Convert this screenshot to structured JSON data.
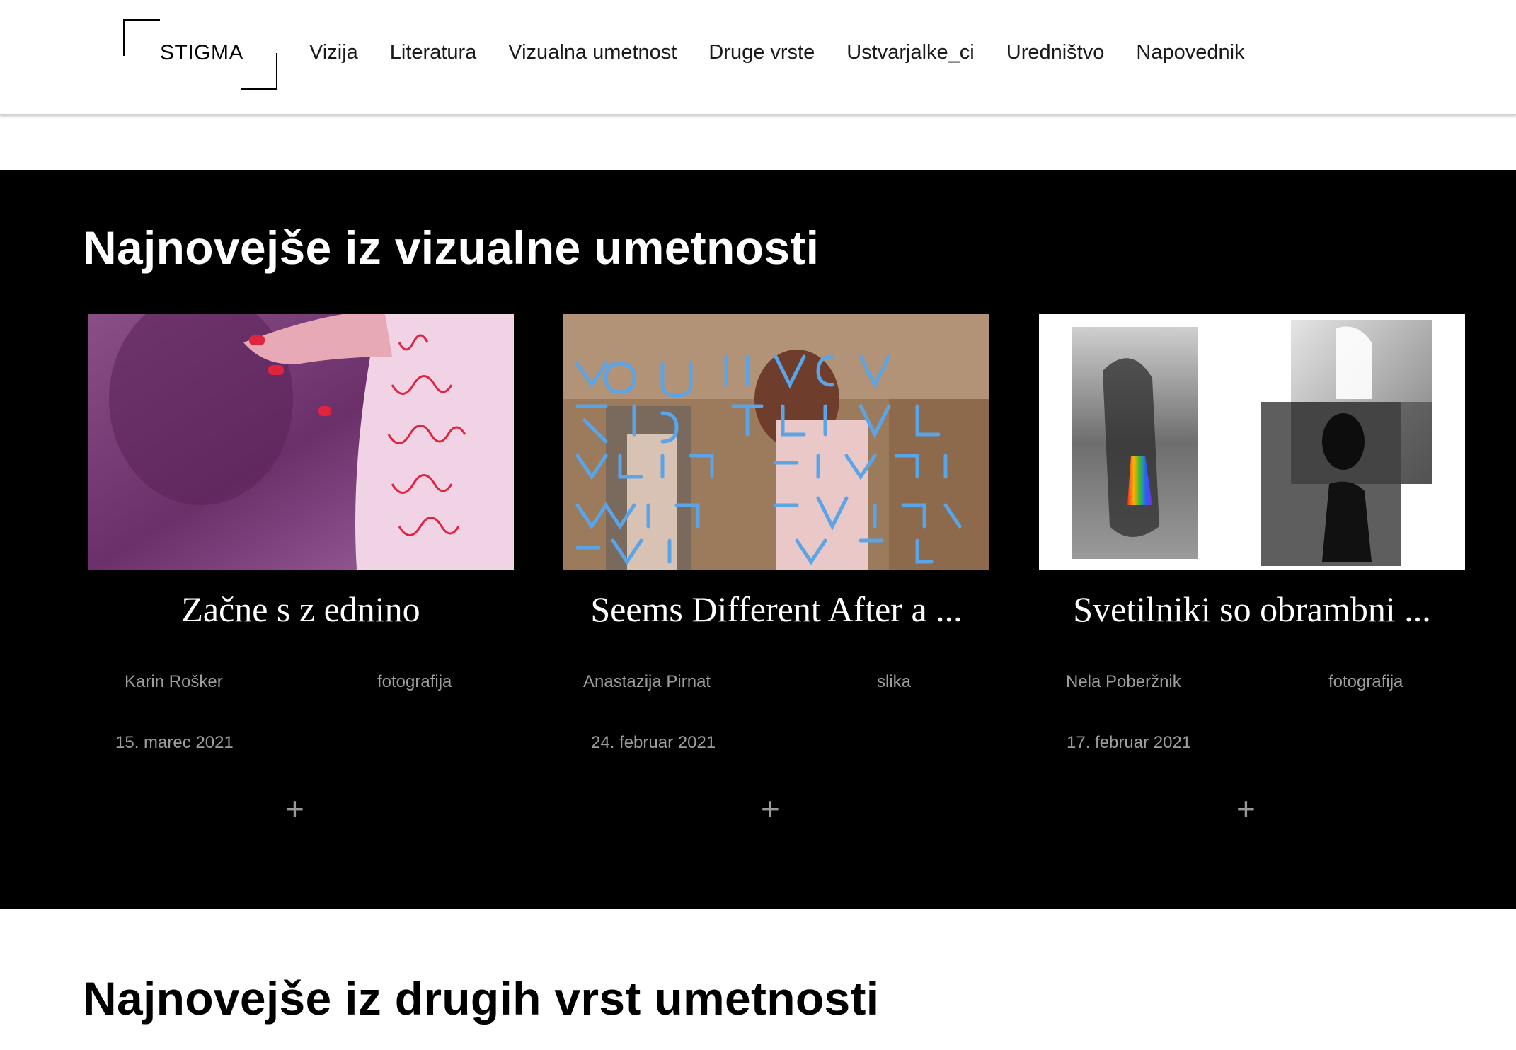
{
  "header": {
    "logo_text": "STIGMA",
    "nav": [
      "Vizija",
      "Literatura",
      "Vizualna umetnost",
      "Druge vrste",
      "Ustvarjalke_ci",
      "Uredništvo",
      "Napovednik"
    ]
  },
  "visual_section": {
    "title": "Najnovejše iz vizualne umetnosti",
    "cards": [
      {
        "title": "Začne s z ednino",
        "author": "Karin Rošker",
        "category": "fotografija",
        "date": "15. marec 2021",
        "plus": "+"
      },
      {
        "title": "Seems Different After a ...",
        "author": "Anastazija Pirnat",
        "category": "slika",
        "date": "24. februar 2021",
        "plus": "+"
      },
      {
        "title": "Svetilniki so obrambni ...",
        "author": "Nela Poberžnik",
        "category": "fotografija",
        "date": "17. februar 2021",
        "plus": "+"
      }
    ]
  },
  "other_section": {
    "title": "Najnovejše iz drugih vrst umetnosti"
  },
  "colors": {
    "dark_section_bg": "#000000",
    "meta_text": "#9e9e9e",
    "card_title": "#ffffff"
  }
}
